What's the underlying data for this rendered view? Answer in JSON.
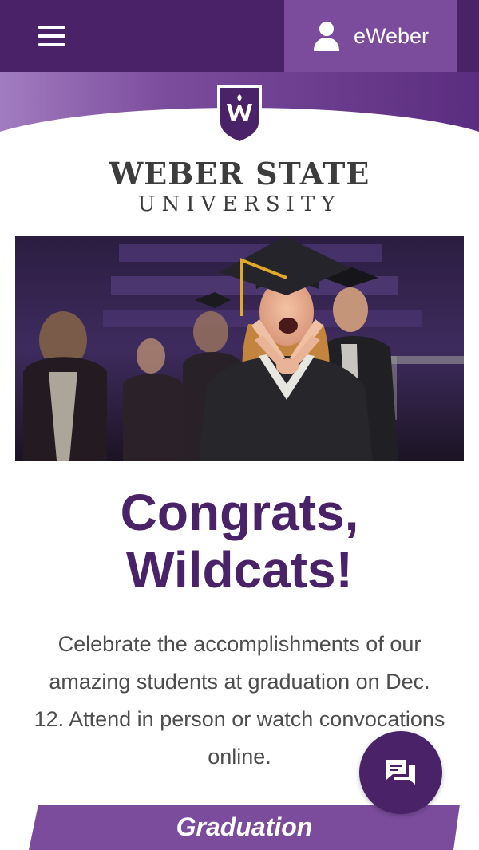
{
  "header": {
    "menu_icon": "hamburger-menu-icon",
    "account_icon": "user-icon",
    "account_label": "eWeber"
  },
  "logo": {
    "line1": "WEBER STATE",
    "line2": "UNIVERSITY"
  },
  "hero": {
    "description": "Graduate in cap and gown making the W hand sign at commencement"
  },
  "main": {
    "headline_line1": "Congrats,",
    "headline_line2": "Wildcats!",
    "body": "Celebrate the accomplishments of our amazing students at graduation on Dec. 12. Attend in person or watch convocations online.",
    "cta_label": "Graduation"
  },
  "chat": {
    "icon": "chat-icon"
  },
  "colors": {
    "brand_purple": "#4a2268",
    "accent_purple": "#7b4c9c",
    "text_gray": "#4d4d4d"
  }
}
